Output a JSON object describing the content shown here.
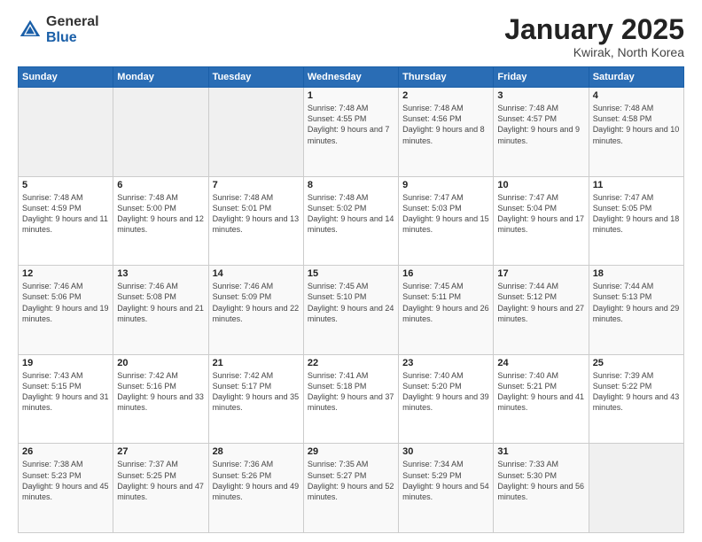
{
  "header": {
    "logo_general": "General",
    "logo_blue": "Blue",
    "month_title": "January 2025",
    "location": "Kwirak, North Korea"
  },
  "days_of_week": [
    "Sunday",
    "Monday",
    "Tuesday",
    "Wednesday",
    "Thursday",
    "Friday",
    "Saturday"
  ],
  "weeks": [
    [
      {
        "day": "",
        "info": ""
      },
      {
        "day": "",
        "info": ""
      },
      {
        "day": "",
        "info": ""
      },
      {
        "day": "1",
        "info": "Sunrise: 7:48 AM\nSunset: 4:55 PM\nDaylight: 9 hours and 7 minutes."
      },
      {
        "day": "2",
        "info": "Sunrise: 7:48 AM\nSunset: 4:56 PM\nDaylight: 9 hours and 8 minutes."
      },
      {
        "day": "3",
        "info": "Sunrise: 7:48 AM\nSunset: 4:57 PM\nDaylight: 9 hours and 9 minutes."
      },
      {
        "day": "4",
        "info": "Sunrise: 7:48 AM\nSunset: 4:58 PM\nDaylight: 9 hours and 10 minutes."
      }
    ],
    [
      {
        "day": "5",
        "info": "Sunrise: 7:48 AM\nSunset: 4:59 PM\nDaylight: 9 hours and 11 minutes."
      },
      {
        "day": "6",
        "info": "Sunrise: 7:48 AM\nSunset: 5:00 PM\nDaylight: 9 hours and 12 minutes."
      },
      {
        "day": "7",
        "info": "Sunrise: 7:48 AM\nSunset: 5:01 PM\nDaylight: 9 hours and 13 minutes."
      },
      {
        "day": "8",
        "info": "Sunrise: 7:48 AM\nSunset: 5:02 PM\nDaylight: 9 hours and 14 minutes."
      },
      {
        "day": "9",
        "info": "Sunrise: 7:47 AM\nSunset: 5:03 PM\nDaylight: 9 hours and 15 minutes."
      },
      {
        "day": "10",
        "info": "Sunrise: 7:47 AM\nSunset: 5:04 PM\nDaylight: 9 hours and 17 minutes."
      },
      {
        "day": "11",
        "info": "Sunrise: 7:47 AM\nSunset: 5:05 PM\nDaylight: 9 hours and 18 minutes."
      }
    ],
    [
      {
        "day": "12",
        "info": "Sunrise: 7:46 AM\nSunset: 5:06 PM\nDaylight: 9 hours and 19 minutes."
      },
      {
        "day": "13",
        "info": "Sunrise: 7:46 AM\nSunset: 5:08 PM\nDaylight: 9 hours and 21 minutes."
      },
      {
        "day": "14",
        "info": "Sunrise: 7:46 AM\nSunset: 5:09 PM\nDaylight: 9 hours and 22 minutes."
      },
      {
        "day": "15",
        "info": "Sunrise: 7:45 AM\nSunset: 5:10 PM\nDaylight: 9 hours and 24 minutes."
      },
      {
        "day": "16",
        "info": "Sunrise: 7:45 AM\nSunset: 5:11 PM\nDaylight: 9 hours and 26 minutes."
      },
      {
        "day": "17",
        "info": "Sunrise: 7:44 AM\nSunset: 5:12 PM\nDaylight: 9 hours and 27 minutes."
      },
      {
        "day": "18",
        "info": "Sunrise: 7:44 AM\nSunset: 5:13 PM\nDaylight: 9 hours and 29 minutes."
      }
    ],
    [
      {
        "day": "19",
        "info": "Sunrise: 7:43 AM\nSunset: 5:15 PM\nDaylight: 9 hours and 31 minutes."
      },
      {
        "day": "20",
        "info": "Sunrise: 7:42 AM\nSunset: 5:16 PM\nDaylight: 9 hours and 33 minutes."
      },
      {
        "day": "21",
        "info": "Sunrise: 7:42 AM\nSunset: 5:17 PM\nDaylight: 9 hours and 35 minutes."
      },
      {
        "day": "22",
        "info": "Sunrise: 7:41 AM\nSunset: 5:18 PM\nDaylight: 9 hours and 37 minutes."
      },
      {
        "day": "23",
        "info": "Sunrise: 7:40 AM\nSunset: 5:20 PM\nDaylight: 9 hours and 39 minutes."
      },
      {
        "day": "24",
        "info": "Sunrise: 7:40 AM\nSunset: 5:21 PM\nDaylight: 9 hours and 41 minutes."
      },
      {
        "day": "25",
        "info": "Sunrise: 7:39 AM\nSunset: 5:22 PM\nDaylight: 9 hours and 43 minutes."
      }
    ],
    [
      {
        "day": "26",
        "info": "Sunrise: 7:38 AM\nSunset: 5:23 PM\nDaylight: 9 hours and 45 minutes."
      },
      {
        "day": "27",
        "info": "Sunrise: 7:37 AM\nSunset: 5:25 PM\nDaylight: 9 hours and 47 minutes."
      },
      {
        "day": "28",
        "info": "Sunrise: 7:36 AM\nSunset: 5:26 PM\nDaylight: 9 hours and 49 minutes."
      },
      {
        "day": "29",
        "info": "Sunrise: 7:35 AM\nSunset: 5:27 PM\nDaylight: 9 hours and 52 minutes."
      },
      {
        "day": "30",
        "info": "Sunrise: 7:34 AM\nSunset: 5:29 PM\nDaylight: 9 hours and 54 minutes."
      },
      {
        "day": "31",
        "info": "Sunrise: 7:33 AM\nSunset: 5:30 PM\nDaylight: 9 hours and 56 minutes."
      },
      {
        "day": "",
        "info": ""
      }
    ]
  ]
}
